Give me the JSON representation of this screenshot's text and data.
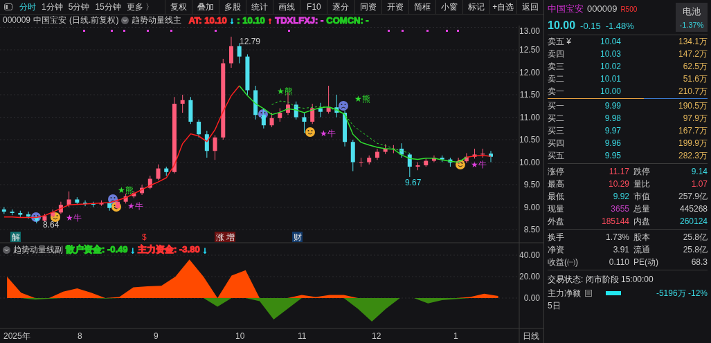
{
  "toolbar": {
    "tabs": [
      {
        "label": "分时",
        "selected": true
      },
      {
        "label": "1分钟",
        "selected": false
      },
      {
        "label": "5分钟",
        "selected": false
      },
      {
        "label": "15分钟",
        "selected": false
      }
    ],
    "more": "更多 〉",
    "buttons": [
      "复权",
      "叠加",
      "多股",
      "统计",
      "画线",
      "F10",
      "逐分",
      "同资",
      "开资",
      "简框",
      "小窗",
      "标记",
      "+自选",
      "返回"
    ]
  },
  "chart": {
    "code": "000009",
    "name": "中国宝安",
    "mode": "(日线.前复权)",
    "indicator": "趋势动量线主",
    "legend": [
      {
        "text": "AT: 10.10",
        "color": "#ff3333"
      },
      {
        "text": "↓",
        "color": "#22d3ee"
      },
      {
        "text": ": 10.10",
        "color": "#22cc22"
      },
      {
        "text": "↑",
        "color": "#ff3333"
      },
      {
        "text": "TDXLFXJ: -",
        "color": "#e040e0"
      },
      {
        "text": "COMCN: -",
        "color": "#22cc22"
      }
    ],
    "chart_data": {
      "type": "candlestick",
      "ylim": [
        8.5,
        13
      ],
      "grid": true,
      "yticks": [
        {
          "value": 13,
          "label": "13.00"
        },
        {
          "value": 12.5,
          "label": "12.50"
        },
        {
          "value": 12,
          "label": "12.00"
        },
        {
          "value": 11.5,
          "label": "11.50"
        },
        {
          "value": 11,
          "label": "11.00"
        },
        {
          "value": 10.5,
          "label": "10.50"
        },
        {
          "value": 10,
          "label": "10.00"
        },
        {
          "value": 9.5,
          "label": "9.50"
        },
        {
          "value": 9,
          "label": "9.00"
        },
        {
          "value": 8.5,
          "label": "8.50"
        }
      ],
      "ohlc": [
        [
          8.95,
          9.0,
          8.85,
          8.9
        ],
        [
          8.9,
          8.95,
          8.82,
          8.87
        ],
        [
          8.87,
          8.92,
          8.78,
          8.83
        ],
        [
          8.84,
          8.9,
          8.74,
          8.79
        ],
        [
          8.78,
          8.8,
          8.64,
          8.7
        ],
        [
          8.7,
          8.85,
          8.68,
          8.8
        ],
        [
          8.8,
          8.95,
          8.76,
          8.88
        ],
        [
          8.88,
          9.12,
          8.85,
          9.05
        ],
        [
          9.05,
          9.35,
          9.0,
          9.17
        ],
        [
          9.17,
          9.22,
          9.05,
          9.1
        ],
        [
          9.1,
          9.15,
          9.02,
          9.07
        ],
        [
          9.07,
          9.12,
          9.0,
          9.06
        ],
        [
          9.06,
          9.15,
          9.03,
          9.09
        ],
        [
          9.09,
          9.12,
          8.92,
          8.98
        ],
        [
          8.98,
          9.18,
          8.95,
          9.12
        ],
        [
          9.12,
          9.3,
          9.08,
          9.24
        ],
        [
          9.24,
          9.36,
          9.2,
          9.31
        ],
        [
          9.31,
          9.5,
          9.27,
          9.43
        ],
        [
          9.43,
          9.7,
          9.4,
          9.63
        ],
        [
          9.63,
          9.95,
          9.6,
          9.86
        ],
        [
          9.86,
          9.9,
          9.7,
          9.78
        ],
        [
          9.78,
          11.45,
          9.75,
          11.3
        ],
        [
          11.3,
          11.5,
          11.1,
          11.38
        ],
        [
          11.38,
          11.45,
          10.85,
          10.9
        ],
        [
          10.9,
          10.95,
          10.55,
          10.62
        ],
        [
          10.62,
          10.7,
          10.1,
          10.25
        ],
        [
          10.25,
          10.6,
          10.05,
          10.55
        ],
        [
          10.55,
          12.3,
          10.5,
          12.2
        ],
        [
          12.2,
          12.79,
          12.1,
          12.58
        ],
        [
          12.58,
          12.65,
          12.2,
          12.35
        ],
        [
          12.35,
          12.4,
          11.5,
          11.6
        ],
        [
          11.6,
          11.7,
          10.95,
          11.05
        ],
        [
          11.05,
          11.2,
          10.75,
          10.82
        ],
        [
          10.82,
          11.1,
          10.78,
          10.98
        ],
        [
          10.98,
          11.2,
          10.9,
          11.1
        ],
        [
          11.1,
          11.55,
          11.05,
          11.28
        ],
        [
          11.28,
          11.35,
          10.95,
          11.0
        ],
        [
          11.0,
          11.1,
          10.65,
          10.9
        ],
        [
          10.9,
          11.3,
          10.85,
          11.2
        ],
        [
          11.2,
          11.32,
          11.0,
          11.12
        ],
        [
          11.12,
          11.7,
          11.08,
          11.22
        ],
        [
          11.22,
          11.5,
          11.0,
          11.1
        ],
        [
          11.1,
          11.15,
          10.35,
          10.45
        ],
        [
          10.45,
          10.5,
          9.8,
          10.0
        ],
        [
          10.0,
          10.1,
          9.9,
          10.0
        ],
        [
          10.0,
          10.15,
          9.95,
          10.1
        ],
        [
          10.1,
          10.3,
          10.05,
          10.23
        ],
        [
          10.23,
          10.4,
          10.18,
          10.3
        ],
        [
          10.3,
          10.38,
          10.2,
          10.3
        ],
        [
          10.3,
          10.42,
          10.1,
          10.17
        ],
        [
          10.17,
          10.2,
          9.67,
          9.9
        ],
        [
          9.9,
          10.0,
          9.82,
          9.93
        ],
        [
          9.93,
          10.08,
          9.9,
          10.03
        ],
        [
          10.03,
          10.15,
          10.0,
          10.1
        ],
        [
          10.1,
          10.15,
          10.0,
          10.06
        ],
        [
          10.06,
          10.1,
          9.9,
          9.99
        ],
        [
          9.99,
          10.1,
          9.95,
          10.02
        ],
        [
          10.02,
          10.2,
          9.98,
          10.12
        ],
        [
          10.12,
          10.3,
          10.08,
          10.17
        ],
        [
          10.17,
          10.3,
          10.1,
          10.19
        ],
        [
          10.19,
          10.25,
          10.0,
          10.12
        ],
        null,
        null,
        null
      ],
      "series": [
        {
          "type": "line",
          "color": "#ff2020",
          "line_style": "solid",
          "values": [
            8.78,
            8.78,
            8.77,
            8.77,
            8.77,
            8.81,
            8.89,
            8.97,
            9.05,
            9.06,
            9.07,
            9.08,
            9.09,
            9.1,
            9.15,
            9.21,
            9.3,
            9.39,
            9.48,
            9.56,
            9.65,
            9.94,
            10.41,
            10.63,
            10.58,
            10.46,
            10.72,
            11.13,
            11.48,
            11.7,
            null,
            null,
            null,
            null,
            null,
            null,
            null,
            null,
            null,
            null,
            null,
            null,
            null,
            null,
            null,
            null,
            null,
            null,
            null,
            null,
            null,
            null,
            null,
            null,
            null,
            null,
            null,
            10.11,
            10.14,
            10.15,
            10.13,
            null,
            null,
            null
          ]
        },
        {
          "type": "line",
          "color": "#30e030",
          "line_style": "solid",
          "values": [
            null,
            null,
            null,
            null,
            null,
            null,
            null,
            null,
            null,
            null,
            null,
            null,
            null,
            null,
            null,
            null,
            null,
            null,
            null,
            null,
            null,
            null,
            null,
            null,
            null,
            null,
            null,
            null,
            null,
            11.7,
            11.48,
            11.3,
            11.19,
            11.06,
            11.11,
            11.19,
            11.16,
            11.1,
            11.16,
            11.21,
            11.23,
            11.17,
            11.06,
            10.62,
            10.44,
            10.38,
            10.33,
            10.3,
            10.29,
            10.16,
            10.08,
            10.06,
            10.09,
            10.09,
            10.05,
            10.02,
            10.0,
            10.11,
            null,
            null,
            null,
            null,
            null,
            null
          ]
        },
        {
          "type": "line",
          "color": "#30e030",
          "line_style": "dashed",
          "values": [
            null,
            null,
            null,
            null,
            null,
            null,
            null,
            null,
            null,
            null,
            null,
            null,
            null,
            null,
            null,
            null,
            null,
            null,
            null,
            null,
            null,
            null,
            null,
            null,
            null,
            null,
            null,
            null,
            null,
            null,
            null,
            null,
            null,
            11.28,
            11.36,
            11.34,
            11.22,
            11.2,
            11.22,
            11.24,
            11.22,
            11.14,
            11.07,
            10.82,
            10.68,
            10.55,
            10.42,
            10.37,
            10.3,
            10.25,
            10.2,
            null,
            null,
            null,
            null,
            null,
            null,
            null,
            null,
            null,
            null,
            null,
            null,
            null
          ]
        }
      ]
    },
    "price_labels": [
      "12.79",
      "8.64",
      "9.67"
    ],
    "signals": [
      {
        "kind": "bull",
        "text": "★牛"
      },
      {
        "kind": "bear",
        "text": "★熊"
      },
      {
        "kind": "bull",
        "text": "★牛"
      },
      {
        "kind": "bear",
        "text": "★熊"
      },
      {
        "kind": "bull",
        "text": "★牛"
      },
      {
        "kind": "bear",
        "text": "★熊"
      },
      {
        "kind": "bull",
        "text": "★牛"
      }
    ],
    "events": [
      {
        "text": "解",
        "color": "#0e6b6b"
      },
      {
        "text": "$"
      },
      {
        "text": "涨",
        "color": "#6b1010"
      },
      {
        "text": "增",
        "color": "#6b1010"
      },
      {
        "text": "财",
        "color": "#123a6b"
      }
    ],
    "sub": {
      "indicator": "趋势动量线副",
      "legend": [
        {
          "text": "散户资金: -0.49",
          "color": "#22cc22"
        },
        {
          "text": "↓",
          "color": "#22d3ee"
        },
        {
          "text": "主力资金: -3.80",
          "color": "#ff3333"
        },
        {
          "text": "↓",
          "color": "#22d3ee"
        }
      ],
      "chart_data": {
        "type": "area",
        "ylim": [
          -42.6,
          40
        ],
        "grid": true,
        "yticks": [
          {
            "value": 40,
            "label": "40.00"
          },
          {
            "value": 20,
            "label": "20.00"
          },
          {
            "value": 0,
            "label": "0.00"
          }
        ],
        "series": [
          {
            "color": "#ff4a00",
            "values": [
              20,
              5,
              0,
              0,
              6,
              9,
              5,
              0,
              1,
              10,
              11,
              11.5,
              20,
              36,
              20,
              0,
              21,
              26,
              0,
              0,
              0,
              3,
              1,
              3,
              3,
              0,
              0,
              0,
              0,
              0,
              0,
              0,
              0,
              1,
              4,
              2,
              null
            ]
          },
          {
            "color": "#3a8a10",
            "values": [
              0,
              0,
              -1.5,
              -0.6,
              0,
              0,
              0,
              -0.5,
              0,
              0,
              0,
              0,
              0,
              0,
              0,
              -8,
              0,
              0,
              -3,
              -20,
              -10,
              0,
              0,
              0,
              0,
              -10,
              -22,
              -10,
              0,
              0,
              -5,
              -2,
              -1,
              0,
              0,
              0,
              null
            ]
          }
        ]
      }
    },
    "dates": [
      "2025年",
      "8",
      "9",
      "10",
      "11",
      "12",
      "1"
    ],
    "period": "日线"
  },
  "quote": {
    "name": "中国宝安",
    "code": "000009",
    "badge": "R500",
    "price": "10.00",
    "change": "-0.15",
    "change_pct": "-1.48%",
    "sector": {
      "name": "电池",
      "change": "-1.37%"
    },
    "asks": [
      {
        "label": "卖五 ¥",
        "price": "10.04",
        "volume": "134.1万"
      },
      {
        "label": "卖四",
        "price": "10.03",
        "volume": "147.2万"
      },
      {
        "label": "卖三",
        "price": "10.02",
        "volume": "62.5万"
      },
      {
        "label": "卖二",
        "price": "10.01",
        "volume": "51.6万"
      },
      {
        "label": "卖一",
        "price": "10.00",
        "volume": "210.7万"
      }
    ],
    "bids": [
      {
        "label": "买一",
        "price": "9.99",
        "volume": "190.5万"
      },
      {
        "label": "买二",
        "price": "9.98",
        "volume": "97.9万"
      },
      {
        "label": "买三",
        "price": "9.97",
        "volume": "167.7万"
      },
      {
        "label": "买四",
        "price": "9.96",
        "volume": "199.9万"
      },
      {
        "label": "买五",
        "price": "9.95",
        "volume": "282.3万"
      }
    ],
    "stats": [
      {
        "label": "涨停",
        "value": "11.17",
        "color": "#ff4d5e"
      },
      {
        "label": "跌停",
        "value": "9.14",
        "color": "#3ad6e0"
      },
      {
        "label": "最高",
        "value": "10.29",
        "color": "#ff4d5e"
      },
      {
        "label": "量比",
        "value": "1.07",
        "color": "#ff4d5e"
      },
      {
        "label": "最低",
        "value": "9.92",
        "color": "#3ad6e0"
      },
      {
        "label": "市值",
        "value": "257.9亿",
        "color": "#c8c8c8"
      },
      {
        "label": "现量",
        "value": "3655",
        "color": "#c040c0"
      },
      {
        "label": "总量",
        "value": "445268",
        "color": "#c8c8c8"
      },
      {
        "label": "外盘",
        "value": "185144",
        "color": "#ff4d5e"
      },
      {
        "label": "内盘",
        "value": "260124",
        "color": "#3ad6e0"
      }
    ],
    "stats2": [
      {
        "label": "换手",
        "value": "1.73%"
      },
      {
        "label": "股本",
        "value": "25.8亿"
      },
      {
        "label": "净资",
        "value": "3.91"
      },
      {
        "label": "流通",
        "value": "25.8亿"
      },
      {
        "label": "收益(㈠)",
        "value": "0.110"
      },
      {
        "label": "PE(动)",
        "value": "68.3"
      }
    ],
    "status": "交易状态: 闭市阶段 15:00:00",
    "flow": {
      "label": "主力净额",
      "value": "-5196万 -12%"
    },
    "next": "5日"
  }
}
